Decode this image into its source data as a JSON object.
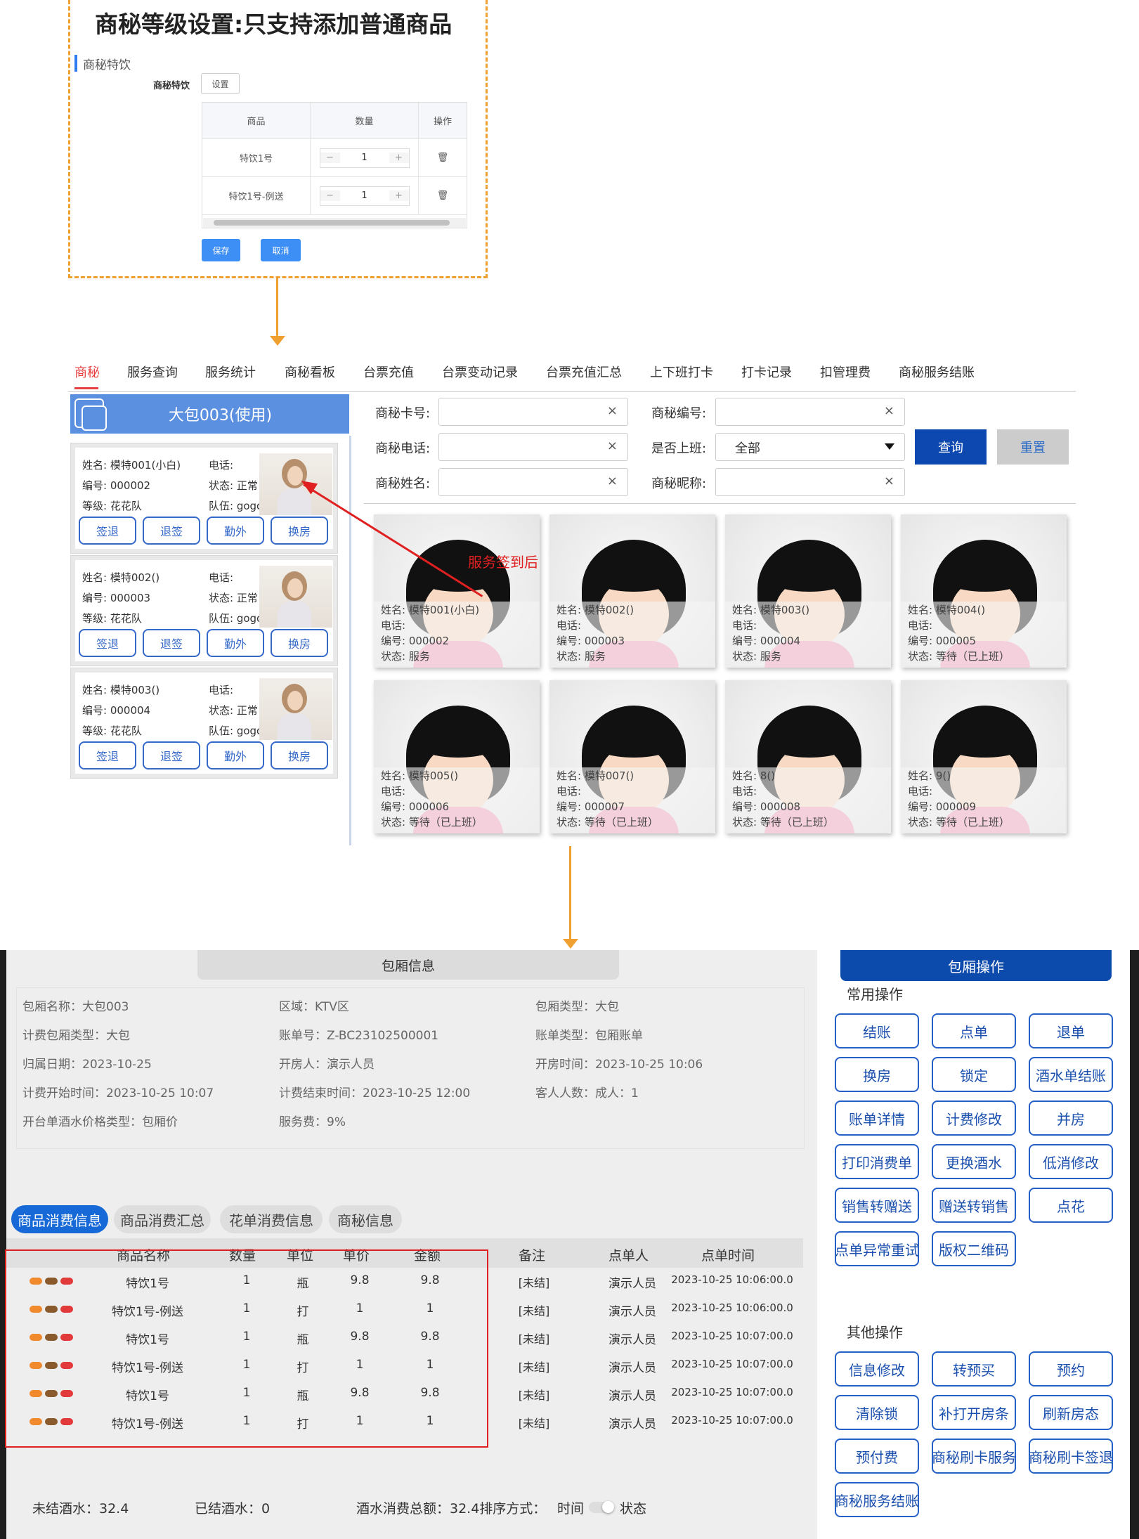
{
  "section1": {
    "title": "商秘等级设置:只支持添加普通商品",
    "subtitle": "商秘特饮",
    "field_label": "商秘特饮",
    "set_button": "设置",
    "table_headers": [
      "商品",
      "数量",
      "操作"
    ],
    "rows": [
      {
        "name": "特饮1号",
        "qty": "1"
      },
      {
        "name": "特饮1号-例送",
        "qty": "1"
      }
    ],
    "minus": "−",
    "plus": "+",
    "trash": "🗑",
    "save_button": "保存",
    "cancel_button": "取消"
  },
  "nav": {
    "tabs": [
      "商秘",
      "服务查询",
      "服务统计",
      "商秘看板",
      "台票充值",
      "台票变动记录",
      "台票充值汇总",
      "上下班打卡",
      "打卡记录",
      "扣管理费",
      "商秘服务结账"
    ]
  },
  "room_panel": {
    "title": "大包003(使用)",
    "cards": [
      {
        "name": "姓名:  模特001(小白)",
        "phone": "电话:",
        "id": "编号:  000002",
        "status": "状态:   正常",
        "level": "等级:  花花队",
        "team": "队伍:   gogo"
      },
      {
        "name": "姓名:  模特002()",
        "phone": "电话:",
        "id": "编号:  000003",
        "status": "状态:   正常",
        "level": "等级:  花花队",
        "team": "队伍:   gogo"
      },
      {
        "name": "姓名:  模特003()",
        "phone": "电话:",
        "id": "编号:  000004",
        "status": "状态:   正常",
        "level": "等级:  花花队",
        "team": "队伍:   gogo"
      }
    ],
    "buttons": [
      "签退",
      "退签",
      "勤外",
      "换房"
    ]
  },
  "search": {
    "card_no_label": "商秘卡号:",
    "code_label": "商秘编号:",
    "phone_label": "商秘电话:",
    "onduty_label": "是否上班:",
    "name_label": "商秘姓名:",
    "nick_label": "商秘昵称:",
    "onduty_value": "全部",
    "clear": "×",
    "query_button": "查询",
    "reset_button": "重置"
  },
  "models": [
    {
      "name": "姓名:    模特001(小白)",
      "phone": "电话:",
      "id": "编号:    000002",
      "status": "状态:    服务"
    },
    {
      "name": "姓名:    模特002()",
      "phone": "电话:",
      "id": "编号:    000003",
      "status": "状态:    服务"
    },
    {
      "name": "姓名:    模特003()",
      "phone": "电话:",
      "id": "编号:    000004",
      "status": "状态:    服务"
    },
    {
      "name": "姓名:    模特004()",
      "phone": "电话:",
      "id": "编号:    000005",
      "status": "状态:    等待（已上班）"
    },
    {
      "name": "姓名:    模特005()",
      "phone": "电话:",
      "id": "编号:    000006",
      "status": "状态:    等待（已上班）"
    },
    {
      "name": "姓名:    模特007()",
      "phone": "电话:",
      "id": "编号:    000007",
      "status": "状态:    等待（已上班）"
    },
    {
      "name": "姓名:    8()",
      "phone": "电话:",
      "id": "编号:    000008",
      "status": "状态:    等待（已上班）"
    },
    {
      "name": "姓名:    9()",
      "phone": "电话:",
      "id": "编号:    000009",
      "status": "状态:    等待（已上班）"
    }
  ],
  "callout": "服务签到后",
  "room_info": {
    "title": "包厢信息",
    "fields": [
      "包厢名称：大包003",
      "区域：KTV区",
      "包厢类型：大包",
      "计费包厢类型：大包",
      "账单号：Z-BC23102500001",
      "账单类型：包厢账单",
      "归属日期：2023-10-25",
      "开房人：演示人员",
      "开房时间：2023-10-25 10:06",
      "计费开始时间：2023-10-25 10:07",
      "计费结束时间：2023-10-25 12:00",
      "客人人数：成人：1",
      "开台单酒水价格类型：包厢价",
      "服务费：9%"
    ]
  },
  "consume_tabs": [
    "商品消费信息",
    "商品消费汇总",
    "花单消费信息",
    "商秘信息"
  ],
  "consume_table": {
    "headers": [
      "商品名称",
      "数量",
      "单位",
      "单价",
      "金额",
      "备注",
      "点单人",
      "点单时间"
    ],
    "rows": [
      [
        "特饮1号",
        "1",
        "瓶",
        "9.8",
        "9.8",
        "[未结]",
        "演示人员",
        "2023-10-25 10:06:00.0"
      ],
      [
        "特饮1号-例送",
        "1",
        "打",
        "1",
        "1",
        "[未结]",
        "演示人员",
        "2023-10-25 10:06:00.0"
      ],
      [
        "特饮1号",
        "1",
        "瓶",
        "9.8",
        "9.8",
        "[未结]",
        "演示人员",
        "2023-10-25 10:07:00.0"
      ],
      [
        "特饮1号-例送",
        "1",
        "打",
        "1",
        "1",
        "[未结]",
        "演示人员",
        "2023-10-25 10:07:00.0"
      ],
      [
        "特饮1号",
        "1",
        "瓶",
        "9.8",
        "9.8",
        "[未结]",
        "演示人员",
        "2023-10-25 10:07:00.0"
      ],
      [
        "特饮1号-例送",
        "1",
        "打",
        "1",
        "1",
        "[未结]",
        "演示人员",
        "2023-10-25 10:07:00.0"
      ]
    ],
    "row_icon_colors": [
      "#f08a2c",
      "#8a5a2c",
      "#e23a3a"
    ]
  },
  "footer": {
    "unsettled": "未结酒水：32.4",
    "settled": "已结酒水：0",
    "total": "酒水消费总额：32.4排序方式：",
    "sort_time": "时间",
    "sort_status": "状态"
  },
  "room_ops": {
    "title": "包厢操作",
    "common_label": "常用操作",
    "common": [
      "结账",
      "点单",
      "退单",
      "换房",
      "锁定",
      "酒水单结账",
      "账单详情",
      "计费修改",
      "并房",
      "打印消费单",
      "更换酒水",
      "低消修改",
      "销售转赠送",
      "赠送转销售",
      "点花",
      "点单异常重试",
      "版权二维码"
    ],
    "other_label": "其他操作",
    "other": [
      "信息修改",
      "转预买",
      "预约",
      "清除锁",
      "补打开房条",
      "刷新房态",
      "预付费",
      "商秘刷卡服务",
      "商秘刷卡签退",
      "商秘服务结账"
    ]
  }
}
